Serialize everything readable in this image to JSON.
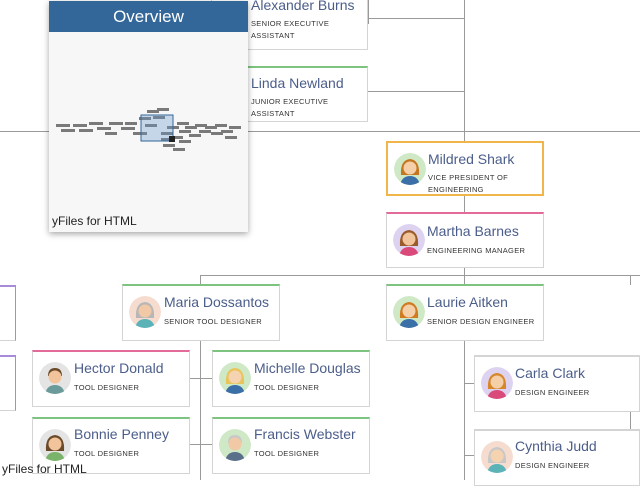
{
  "overview": {
    "title": "Overview",
    "label": "yFiles for HTML"
  },
  "watermark": "yFiles for HTML",
  "colors": {
    "border_green": "#7cc47f",
    "border_pink": "#e36b9a",
    "border_purple": "#a78bd8",
    "border_selected": "#f0b64a"
  },
  "nodes": [
    {
      "name": "Alexander Burns",
      "title": "Senior Executive Assistant"
    },
    {
      "name": "Linda Newland",
      "title": "Junior Executive Assistant"
    },
    {
      "name": "Mildred Shark",
      "title": "Vice President of Engineering"
    },
    {
      "name": "Martha Barnes",
      "title": "Engineering Manager"
    },
    {
      "name": "Maria Dossantos",
      "title": "Senior Tool Designer"
    },
    {
      "name": "Laurie Aitken",
      "title": "Senior Design Engineer"
    },
    {
      "name": "Hector Donald",
      "title": "Tool Designer"
    },
    {
      "name": "Michelle Douglas",
      "title": "Tool Designer"
    },
    {
      "name": "Carla Clark",
      "title": "Design Engineer"
    },
    {
      "name": "Bonnie Penney",
      "title": "Tool Designer"
    },
    {
      "name": "Francis Webster",
      "title": "Tool Designer"
    },
    {
      "name": "Cynthia Judd",
      "title": "Design Engineer"
    }
  ]
}
